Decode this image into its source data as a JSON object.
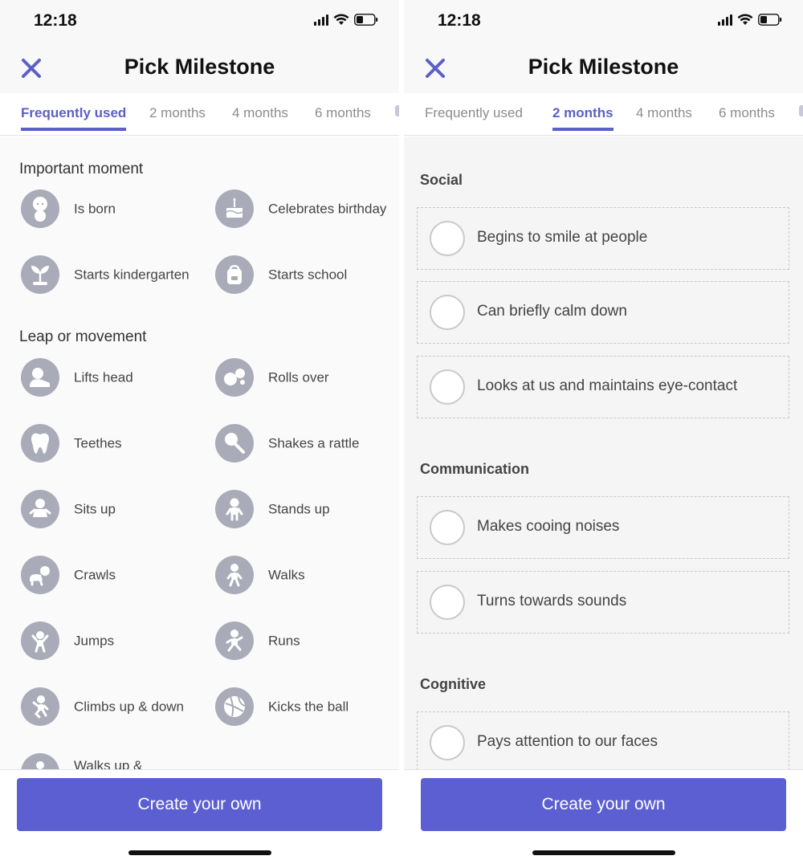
{
  "screens": [
    {
      "status": {
        "time": "12:18"
      },
      "header": {
        "title": "Pick Milestone"
      },
      "tabs": [
        {
          "label": "Frequently used",
          "active": true
        },
        {
          "label": "2 months",
          "active": false
        },
        {
          "label": "4 months",
          "active": false
        },
        {
          "label": "6 months",
          "active": false
        }
      ],
      "sections": [
        {
          "title": "Important moment",
          "items": [
            {
              "label": "Is born",
              "icon": "baby-icon"
            },
            {
              "label": "Celebrates birthday",
              "icon": "birthday-cake-icon"
            },
            {
              "label": "Starts kindergarten",
              "icon": "sprout-icon"
            },
            {
              "label": "Starts school",
              "icon": "backpack-icon"
            }
          ]
        },
        {
          "title": "Leap or movement",
          "items": [
            {
              "label": "Lifts head",
              "icon": "lifting-head-icon"
            },
            {
              "label": "Rolls over",
              "icon": "roll-over-icon"
            },
            {
              "label": "Teethes",
              "icon": "tooth-icon"
            },
            {
              "label": "Shakes a rattle",
              "icon": "rattle-icon"
            },
            {
              "label": "Sits up",
              "icon": "sitting-baby-icon"
            },
            {
              "label": "Stands up",
              "icon": "standing-baby-icon"
            },
            {
              "label": "Crawls",
              "icon": "crawling-baby-icon"
            },
            {
              "label": "Walks",
              "icon": "walking-baby-icon"
            },
            {
              "label": "Jumps",
              "icon": "jumping-baby-icon"
            },
            {
              "label": "Runs",
              "icon": "running-baby-icon"
            },
            {
              "label": "Climbs up & down",
              "icon": "climbing-baby-icon"
            },
            {
              "label": "Kicks the ball",
              "icon": "ball-icon"
            },
            {
              "label": "Walks up &",
              "icon": "stairs-icon"
            }
          ]
        }
      ],
      "footer": {
        "button_label": "Create your own"
      }
    },
    {
      "status": {
        "time": "12:18"
      },
      "header": {
        "title": "Pick Milestone"
      },
      "tabs": [
        {
          "label": "Frequently used",
          "active": false
        },
        {
          "label": "2 months",
          "active": true
        },
        {
          "label": "4 months",
          "active": false
        },
        {
          "label": "6 months",
          "active": false
        }
      ],
      "sections": [
        {
          "title": "Social",
          "items": [
            {
              "label": "Begins to smile at people",
              "checked": false
            },
            {
              "label": "Can briefly calm down",
              "checked": false
            },
            {
              "label": "Looks at us and maintains eye-contact",
              "checked": false
            }
          ]
        },
        {
          "title": "Communication",
          "items": [
            {
              "label": "Makes cooing noises",
              "checked": false
            },
            {
              "label": "Turns towards sounds",
              "checked": false
            }
          ]
        },
        {
          "title": "Cognitive",
          "items": [
            {
              "label": "Pays attention to our faces",
              "checked": false
            }
          ]
        }
      ],
      "footer": {
        "button_label": "Create your own"
      }
    }
  ],
  "colors": {
    "accent": "#5b5fc7",
    "button": "#5b5fd1",
    "icon_circle": "#a9acb8",
    "close_icon": "#5b5fc7"
  }
}
